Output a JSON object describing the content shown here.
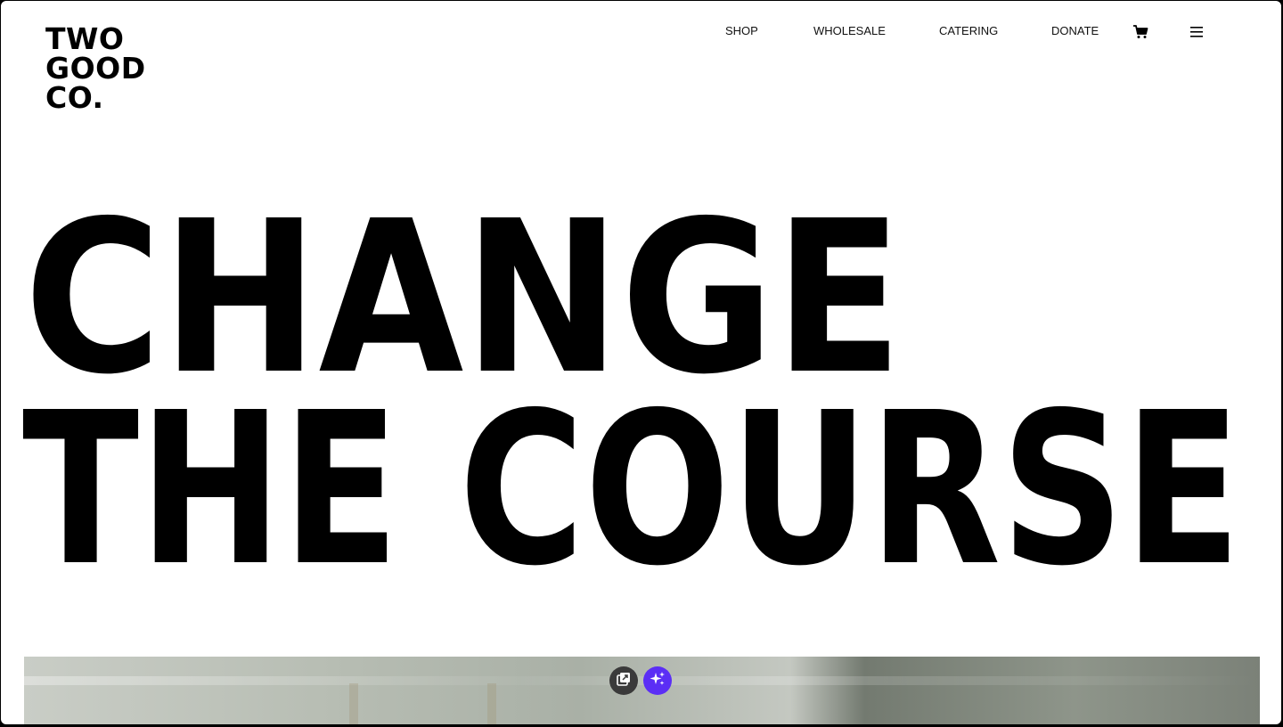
{
  "logo": {
    "line1": "TWO",
    "line2": "GOOD",
    "line3": "CO."
  },
  "nav": {
    "items": [
      "SHOP",
      "WHOLESALE",
      "CATERING",
      "DONATE"
    ],
    "cart_icon": "cart-icon",
    "menu_icon": "hamburger-menu-icon"
  },
  "hero": {
    "line1": "CHANGE",
    "line2": "THE COURSE"
  },
  "floating_buttons": {
    "copy_icon": "open-external-icon",
    "ai_icon": "sparkles-icon",
    "ai_color": "#5b2ef5"
  },
  "colors": {
    "background": "#ffffff",
    "text": "#000000"
  }
}
